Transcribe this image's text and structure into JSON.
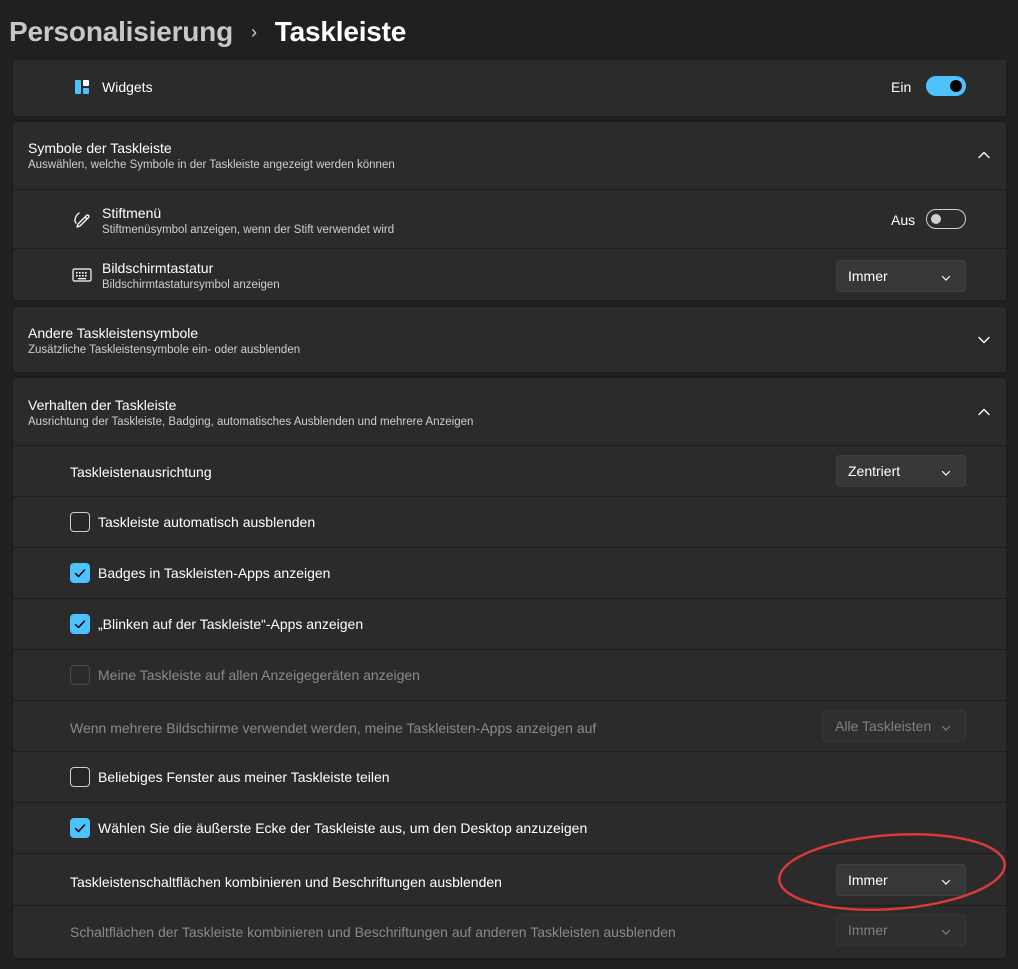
{
  "breadcrumb": {
    "parent": "Personalisierung",
    "separator": "›",
    "current": "Taskleiste"
  },
  "widgets": {
    "label": "Widgets",
    "state_text": "Ein",
    "on": true
  },
  "symbols_section": {
    "title": "Symbole der Taskleiste",
    "subtitle": "Auswählen, welche Symbole in der Taskleiste angezeigt werden können",
    "expanded": true,
    "items": [
      {
        "title": "Stiftmenü",
        "subtitle": "Stiftmenüsymbol anzeigen, wenn der Stift verwendet wird",
        "state_text": "Aus",
        "on": false,
        "icon": "pen-icon"
      },
      {
        "title": "Bildschirmtastatur",
        "subtitle": "Bildschirmtastatursymbol anzeigen",
        "dropdown_value": "Immer",
        "icon": "keyboard-icon"
      }
    ]
  },
  "other_section": {
    "title": "Andere Taskleistensymbole",
    "subtitle": "Zusätzliche Taskleistensymbole ein- oder ausblenden",
    "expanded": false
  },
  "behavior_section": {
    "title": "Verhalten der Taskleiste",
    "subtitle": "Ausrichtung der Taskleiste, Badging, automatisches Ausblenden und mehrere Anzeigen",
    "expanded": true,
    "alignment": {
      "label": "Taskleistenausrichtung",
      "value": "Zentriert"
    },
    "auto_hide": {
      "label": "Taskleiste automatisch ausblenden",
      "checked": false
    },
    "badges": {
      "label": "Badges in Taskleisten-Apps anzeigen",
      "checked": true
    },
    "flashing": {
      "label": "„Blinken auf der Taskleiste“-Apps anzeigen",
      "checked": true
    },
    "all_displays": {
      "label": "Meine Taskleiste auf allen Anzeigegeräten anzeigen",
      "checked": false,
      "disabled": true
    },
    "multi_monitor": {
      "label": "Wenn mehrere Bildschirme verwendet werden, meine Taskleisten-Apps anzeigen auf",
      "value": "Alle Taskleisten",
      "disabled": true
    },
    "share_window": {
      "label": "Beliebiges Fenster aus meiner Taskleiste teilen",
      "checked": false
    },
    "corner_desktop": {
      "label": "Wählen Sie die äußerste Ecke der Taskleiste aus, um den Desktop anzuzeigen",
      "checked": true
    },
    "combine": {
      "label": "Taskleistenschaltflächen kombinieren und Beschriftungen ausblenden",
      "value": "Immer"
    },
    "combine_other": {
      "label": "Schaltflächen der Taskleiste kombinieren und Beschriftungen auf anderen Taskleisten ausblenden",
      "value": "Immer",
      "disabled": true
    }
  },
  "colors": {
    "accent": "#4cc2ff",
    "annotation": "#d93a3a",
    "background": "#202020",
    "card": "#2b2b2b"
  }
}
